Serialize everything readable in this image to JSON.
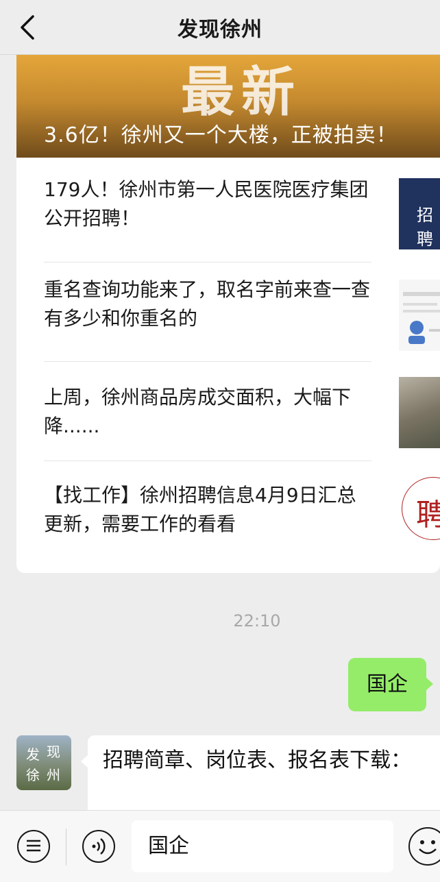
{
  "header": {
    "title": "发现徐州"
  },
  "article_card": {
    "hero_big_text": "最新",
    "hero_caption": "3.6亿！徐州又一个大楼，正被拍卖！",
    "items": [
      {
        "text": "179人！徐州市第一人民医院医疗集团公开招聘！",
        "thumb_text": "招聘"
      },
      {
        "text": "重名查询功能来了，取名字前来查一查有多少和你重名的"
      },
      {
        "text": "上周，徐州商品房成交面积，大幅下降......"
      },
      {
        "text": "【找工作】徐州招聘信息4月9日汇总更新，需要工作的看看",
        "thumb_text": "聘"
      }
    ]
  },
  "chat": {
    "timestamp": "22:10",
    "my_message": "国企",
    "avatar_text": [
      "发",
      "现",
      "徐",
      "州"
    ],
    "reply": "招聘简章、岗位表、报名表下载："
  },
  "input_bar": {
    "value": "国企"
  },
  "colors": {
    "background": "#ededed",
    "my_bubble": "#95ec69",
    "thumb_blue": "#20325e"
  }
}
